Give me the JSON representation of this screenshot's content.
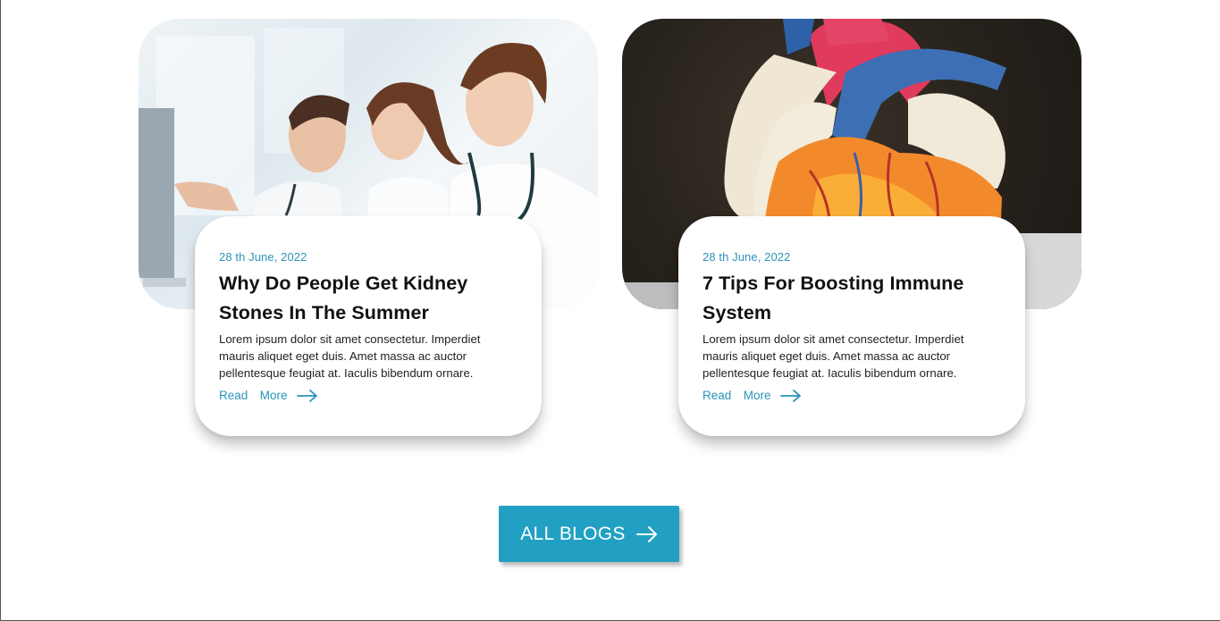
{
  "blogs": [
    {
      "date": "28 th June, 2022",
      "title": "Why Do People Get Kidney Stones In The Summer",
      "excerpt": "Lorem ipsum dolor sit amet consectetur. Imperdiet mauris aliquet eget duis. Amet massa ac auctor pellentesque feugiat at. Iaculis bibendum ornare.",
      "read_more": "Read  More",
      "image": "doctors-photo"
    },
    {
      "date": "28 th June, 2022",
      "title": "7 Tips For Boosting Immune System",
      "excerpt": "Lorem ipsum dolor sit amet consectetur. Imperdiet mauris aliquet eget duis. Amet massa ac auctor pellentesque feugiat at. Iaculis bibendum ornare.",
      "read_more": "Read  More",
      "image": "heart-model-photo"
    }
  ],
  "all_blogs_button": {
    "label": "ALL BLOGS",
    "icon": "arrow-right-icon"
  },
  "colors": {
    "accent": "#22a0c3",
    "link": "#2a93b8",
    "title": "#111111"
  }
}
